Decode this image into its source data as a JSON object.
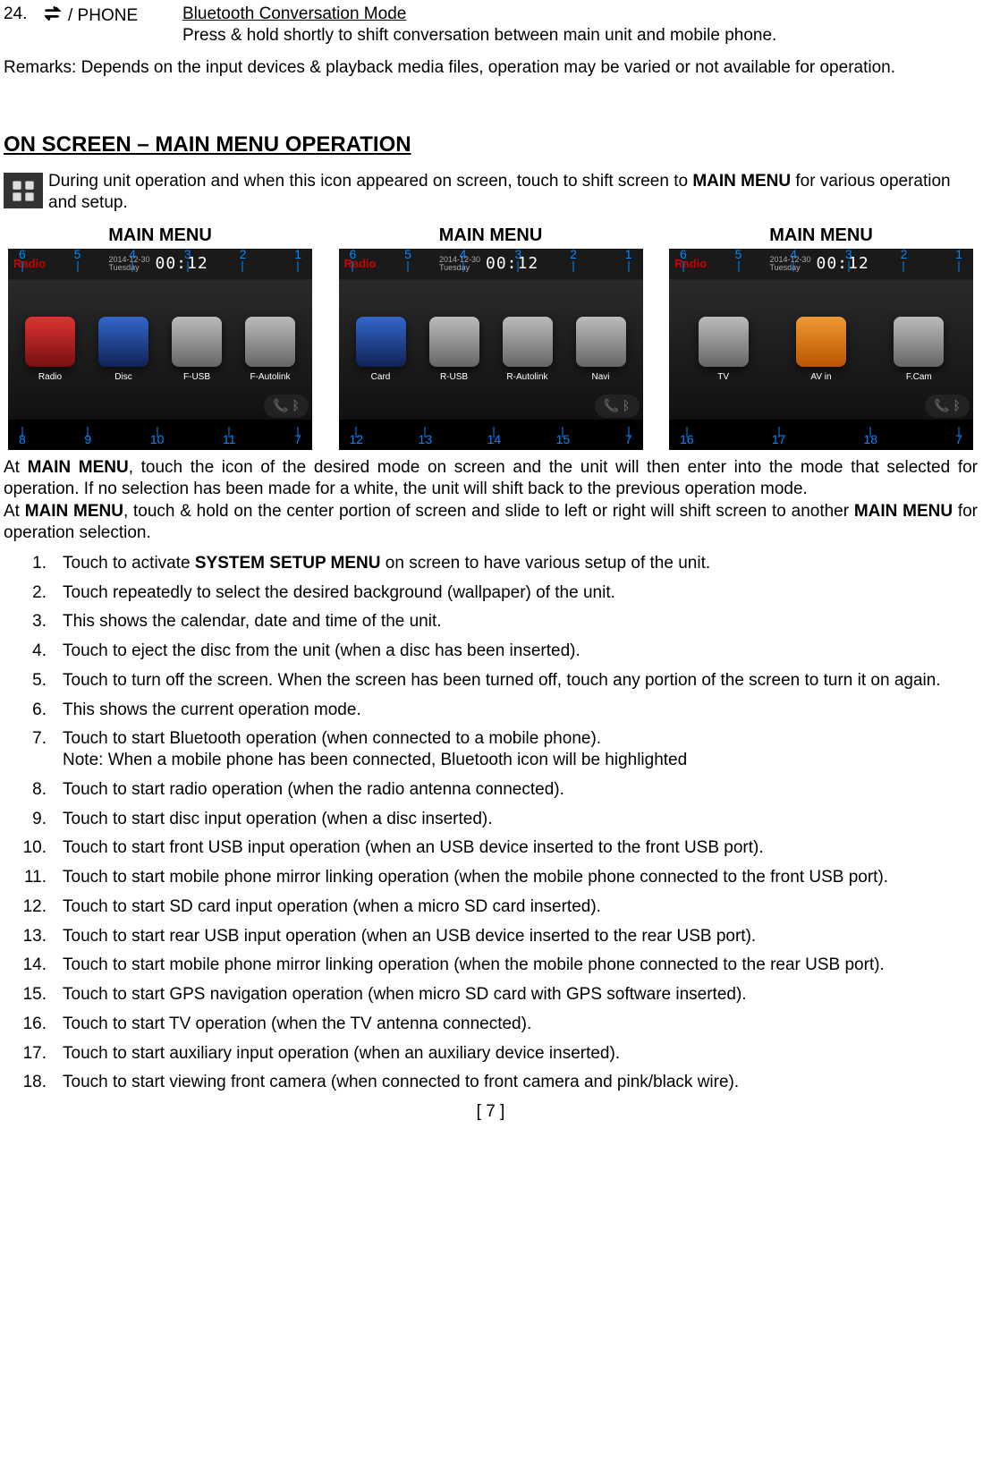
{
  "item24": {
    "number": "24.",
    "icon_label": "/ PHONE",
    "title": "Bluetooth Conversation Mode",
    "desc": "Press & hold shortly to shift conversation between main unit and mobile phone."
  },
  "remarks": "Remarks: Depends on the input devices & playback media files, operation may be varied or not available for operation.",
  "section_title": "ON SCREEN – MAIN MENU OPERATION",
  "mm_intro_a": "During unit operation and when this icon appeared on screen, touch to shift screen to ",
  "mm_intro_bold": "MAIN MENU",
  "mm_intro_b": " for various operation and setup.",
  "screens": {
    "label": "MAIN MENU",
    "mode": "Radio",
    "date": "2014-12-30",
    "day": "Tuesday",
    "time": "00:12",
    "s1": {
      "callouts_top": [
        "6",
        "5",
        "4",
        "3",
        "2",
        "1"
      ],
      "callouts_bot": [
        "8",
        "9",
        "10",
        "11",
        "7"
      ],
      "tiles": [
        {
          "label": "Radio",
          "cls": "red"
        },
        {
          "label": "Disc",
          "cls": "blue"
        },
        {
          "label": "F-USB",
          "cls": "silver"
        },
        {
          "label": "F-Autolink",
          "cls": "silver"
        }
      ]
    },
    "s2": {
      "callouts_top": [
        "6",
        "5",
        "4",
        "3",
        "2",
        "1"
      ],
      "callouts_bot": [
        "12",
        "13",
        "14",
        "15",
        "7"
      ],
      "tiles": [
        {
          "label": "Card",
          "cls": "blue"
        },
        {
          "label": "R-USB",
          "cls": "silver"
        },
        {
          "label": "R-Autolink",
          "cls": "silver"
        },
        {
          "label": "Navi",
          "cls": "silver"
        }
      ]
    },
    "s3": {
      "callouts_top": [
        "6",
        "5",
        "4",
        "3",
        "2",
        "1"
      ],
      "callouts_bot": [
        "16",
        "17",
        "18",
        "7"
      ],
      "tiles": [
        {
          "label": "TV",
          "cls": "silver"
        },
        {
          "label": "AV in",
          "cls": "orange"
        },
        {
          "label": "F.Cam",
          "cls": "silver"
        }
      ]
    }
  },
  "para1_a": "At ",
  "para1_bold": "MAIN MENU",
  "para1_b": ", touch the icon of the desired mode on screen and the unit will then enter into the mode that selected for operation. If no selection has been made for a white, the unit will shift back to the previous operation mode.",
  "para2_a": "At ",
  "para2_bold": "MAIN MENU",
  "para2_b": ", touch & hold on the center portion of screen and slide to left or right will shift screen to another ",
  "para2_bold2": "MAIN MENU",
  "para2_c": " for operation selection.",
  "list": [
    {
      "n": "1.",
      "pre": "Touch to activate ",
      "bold": "SYSTEM SETUP MENU",
      "post": " on screen to have various setup of the unit."
    },
    {
      "n": "2.",
      "t": "Touch repeatedly to select the desired background (wallpaper) of the unit."
    },
    {
      "n": "3.",
      "t": "This shows the calendar, date and time of the unit."
    },
    {
      "n": "4.",
      "t": "Touch to eject the disc from the unit (when a disc has been inserted)."
    },
    {
      "n": "5.",
      "t": "Touch to turn off the screen. When the screen has been turned off, touch any portion of the screen to turn it on again."
    },
    {
      "n": "6.",
      "t": "This shows the current operation mode."
    },
    {
      "n": "7.",
      "t": "Touch to start Bluetooth operation (when connected to a mobile phone).",
      "note": "Note: When a mobile phone has been connected, Bluetooth icon will be highlighted"
    },
    {
      "n": "8.",
      "t": "Touch to start radio operation (when the radio antenna connected)."
    },
    {
      "n": "9.",
      "t": "Touch to start disc input operation (when a disc inserted)."
    },
    {
      "n": "10.",
      "t": "Touch to start front USB input operation (when an USB device inserted to the front USB port)."
    },
    {
      "n": "11.",
      "t": "Touch to start mobile phone mirror linking operation (when the mobile phone connected to the front USB port)."
    },
    {
      "n": "12.",
      "t": "Touch to start SD card input operation (when a micro SD card inserted)."
    },
    {
      "n": "13.",
      "t": "Touch to start rear USB input operation (when an USB device inserted to the rear USB port)."
    },
    {
      "n": "14.",
      "t": "Touch to start mobile phone mirror linking operation (when the mobile phone connected to the rear USB port)."
    },
    {
      "n": "15.",
      "t": "Touch to start GPS navigation operation (when micro SD card with GPS software inserted)."
    },
    {
      "n": "16.",
      "t": "Touch to start TV operation (when the TV antenna connected)."
    },
    {
      "n": "17.",
      "t": "Touch to start auxiliary input operation (when an auxiliary device inserted)."
    },
    {
      "n": "18.",
      "t": "Touch to start viewing front camera (when connected to front camera and pink/black wire)."
    }
  ],
  "footer": "[ 7 ]"
}
